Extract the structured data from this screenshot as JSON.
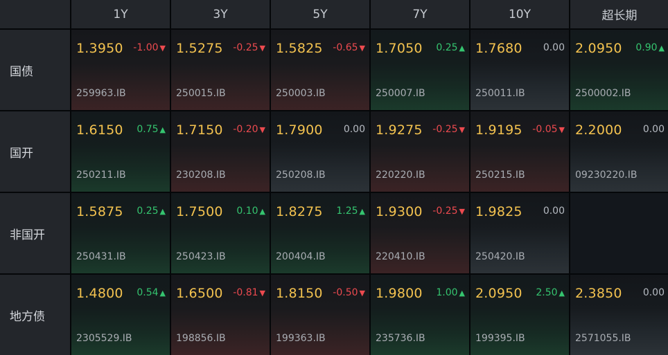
{
  "colors": {
    "up": "#35c46f",
    "down": "#ec4a4f",
    "flat": "#b6bbc2",
    "rate": "#f3c24f"
  },
  "columns": [
    "1Y",
    "3Y",
    "5Y",
    "7Y",
    "10Y",
    "超长期"
  ],
  "rows": [
    {
      "label": "国债",
      "cells": [
        {
          "rate": "1.3950",
          "change": "-1.00",
          "direction": "down",
          "arrow": "▼",
          "code": "259963.IB"
        },
        {
          "rate": "1.5275",
          "change": "-0.25",
          "direction": "down",
          "arrow": "▼",
          "code": "250015.IB"
        },
        {
          "rate": "1.5825",
          "change": "-0.65",
          "direction": "down",
          "arrow": "▼",
          "code": "250003.IB"
        },
        {
          "rate": "1.7050",
          "change": "0.25",
          "direction": "up",
          "arrow": "▲",
          "code": "250007.IB"
        },
        {
          "rate": "1.7680",
          "change": "0.00",
          "direction": "flat",
          "arrow": "",
          "code": "250011.IB"
        },
        {
          "rate": "2.0950",
          "change": "0.90",
          "direction": "up",
          "arrow": "▲",
          "code": "2500002.IB"
        }
      ]
    },
    {
      "label": "国开",
      "cells": [
        {
          "rate": "1.6150",
          "change": "0.75",
          "direction": "up",
          "arrow": "▲",
          "code": "250211.IB"
        },
        {
          "rate": "1.7150",
          "change": "-0.20",
          "direction": "down",
          "arrow": "▼",
          "code": "230208.IB"
        },
        {
          "rate": "1.7900",
          "change": "0.00",
          "direction": "flat",
          "arrow": "",
          "code": "250208.IB"
        },
        {
          "rate": "1.9275",
          "change": "-0.25",
          "direction": "down",
          "arrow": "▼",
          "code": "220220.IB"
        },
        {
          "rate": "1.9195",
          "change": "-0.05",
          "direction": "down",
          "arrow": "▼",
          "code": "250215.IB"
        },
        {
          "rate": "2.2000",
          "change": "0.00",
          "direction": "flat",
          "arrow": "",
          "code": "09230220.IB"
        }
      ]
    },
    {
      "label": "非国开",
      "cells": [
        {
          "rate": "1.5875",
          "change": "0.25",
          "direction": "up",
          "arrow": "▲",
          "code": "250431.IB"
        },
        {
          "rate": "1.7500",
          "change": "0.10",
          "direction": "up",
          "arrow": "▲",
          "code": "250423.IB"
        },
        {
          "rate": "1.8275",
          "change": "1.25",
          "direction": "up",
          "arrow": "▲",
          "code": "200404.IB"
        },
        {
          "rate": "1.9300",
          "change": "-0.25",
          "direction": "down",
          "arrow": "▼",
          "code": "220410.IB"
        },
        {
          "rate": "1.9825",
          "change": "0.00",
          "direction": "flat",
          "arrow": "",
          "code": "250420.IB"
        },
        {
          "empty": true
        }
      ]
    },
    {
      "label": "地方债",
      "cells": [
        {
          "rate": "1.4800",
          "change": "0.54",
          "direction": "up",
          "arrow": "▲",
          "code": "2305529.IB"
        },
        {
          "rate": "1.6500",
          "change": "-0.81",
          "direction": "down",
          "arrow": "▼",
          "code": "198856.IB"
        },
        {
          "rate": "1.8150",
          "change": "-0.50",
          "direction": "down",
          "arrow": "▼",
          "code": "199363.IB"
        },
        {
          "rate": "1.9800",
          "change": "1.00",
          "direction": "up",
          "arrow": "▲",
          "code": "235736.IB"
        },
        {
          "rate": "2.0950",
          "change": "2.50",
          "direction": "up",
          "arrow": "▲",
          "code": "199395.IB"
        },
        {
          "rate": "2.3850",
          "change": "0.00",
          "direction": "flat",
          "arrow": "",
          "code": "2571055.IB"
        }
      ]
    }
  ]
}
